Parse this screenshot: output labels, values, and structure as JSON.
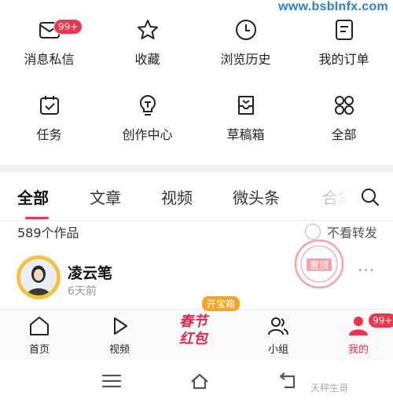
{
  "watermark": "www.bsbInfx.com",
  "quick_grid": {
    "row1": [
      {
        "label": "消息私信",
        "icon": "message-icon",
        "badge": "99+"
      },
      {
        "label": "收藏",
        "icon": "star-icon"
      },
      {
        "label": "浏览历史",
        "icon": "clock-icon"
      },
      {
        "label": "我的订单",
        "icon": "order-icon"
      }
    ],
    "row2": [
      {
        "label": "任务",
        "icon": "calendar-check-icon"
      },
      {
        "label": "创作中心",
        "icon": "lightbulb-icon"
      },
      {
        "label": "草稿箱",
        "icon": "draft-box-icon"
      },
      {
        "label": "全部",
        "icon": "grid-icon"
      }
    ]
  },
  "tabs": [
    "全部",
    "文章",
    "视频",
    "微头条",
    "合集"
  ],
  "content": {
    "count": "589个作品",
    "no_repost_label": "不看转发"
  },
  "post": {
    "author": "凌云笔",
    "time": "6天前",
    "stamp_text": "置顶",
    "more": "···"
  },
  "bottom_nav": {
    "items": [
      {
        "label": "首页",
        "icon": "home-icon"
      },
      {
        "label": "视频",
        "icon": "play-icon"
      },
      {
        "label": "小组",
        "icon": "group-icon"
      },
      {
        "label": "我的",
        "icon": "profile-icon",
        "badge": "99+"
      }
    ],
    "promo": {
      "tag": "开宝箱",
      "line1": "春节",
      "line2": "红包"
    }
  },
  "credit": "天秤生哥",
  "colors": {
    "accent": "#f2344a",
    "promo_orange": "#f6a623",
    "link_blue": "#2a7fd4"
  }
}
